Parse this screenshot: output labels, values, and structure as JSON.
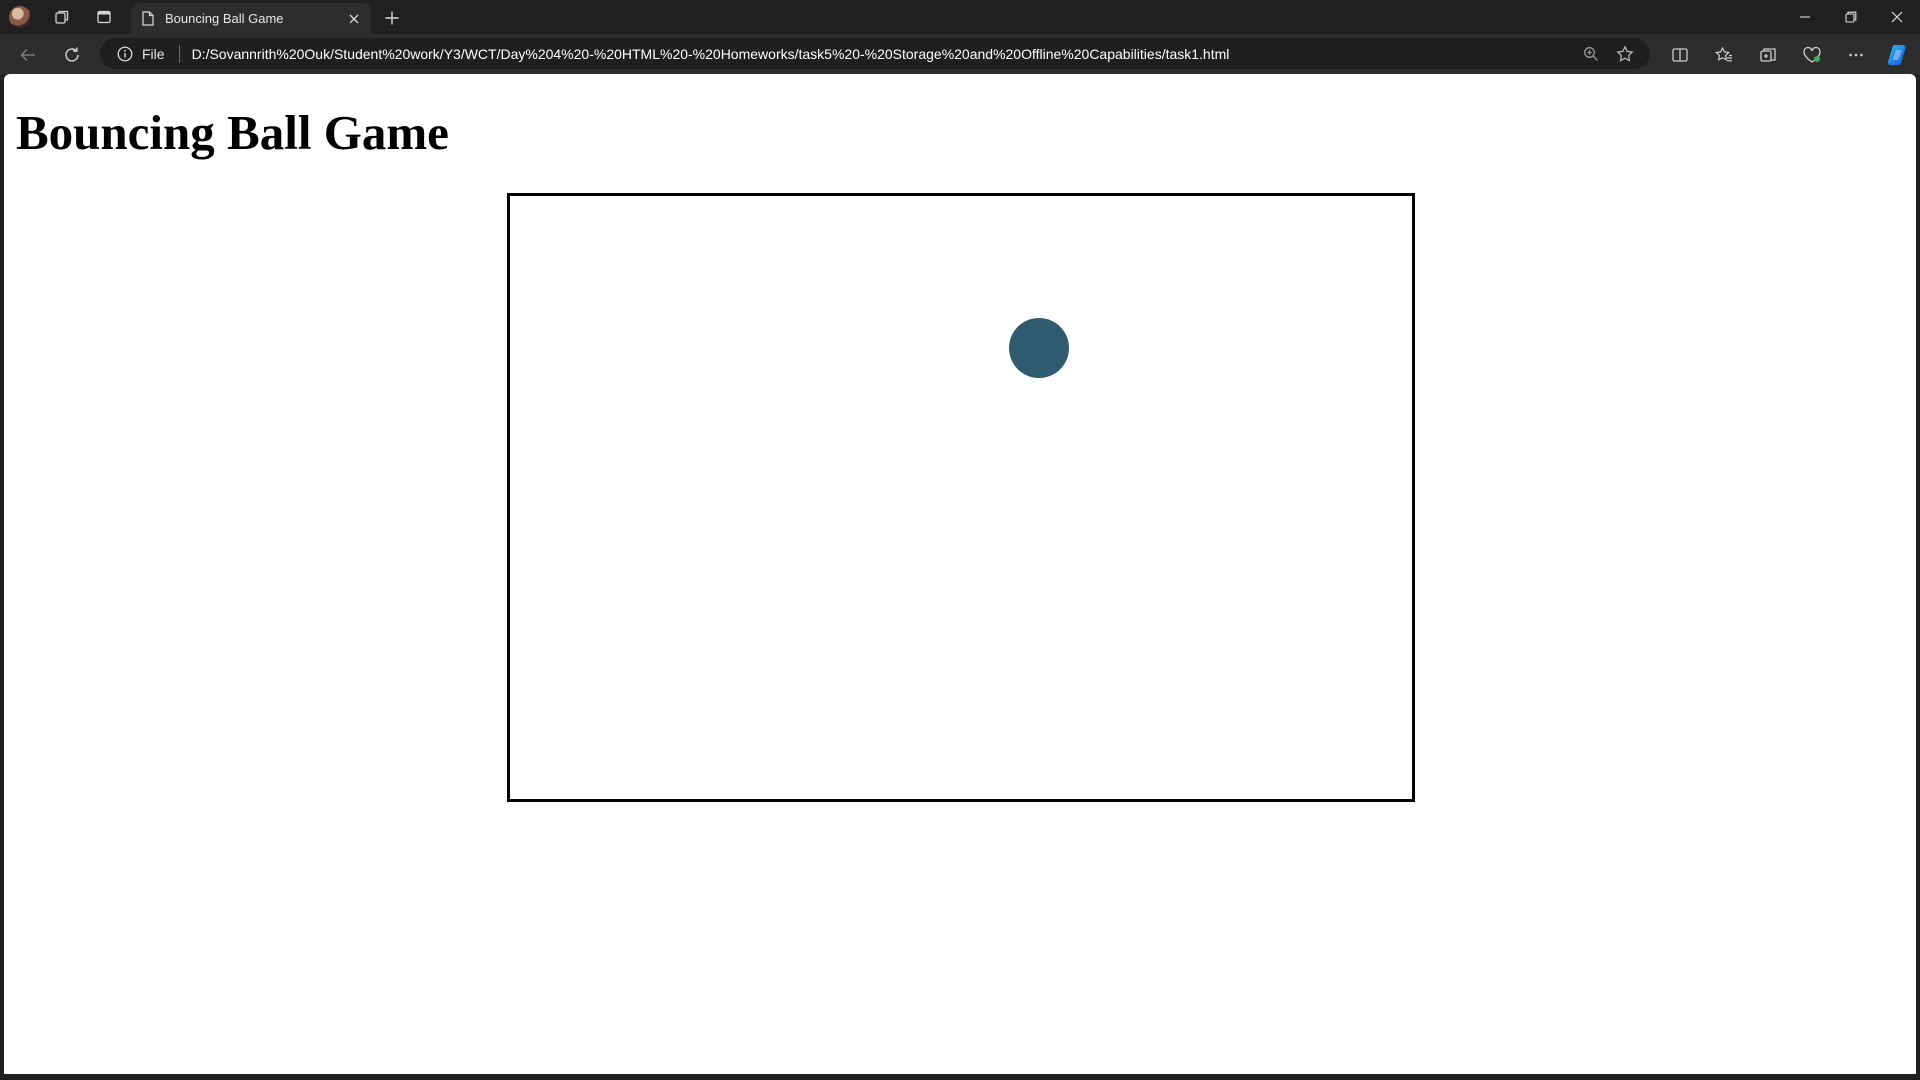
{
  "tab": {
    "title": "Bouncing Ball Game"
  },
  "address_bar": {
    "scheme_label": "File",
    "url": "D:/Sovannrith%20Ouk/Student%20work/Y3/WCT/Day%204%20-%20HTML%20-%20Homeworks/task5%20-%20Storage%20and%20Offline%20Capabilities/task1.html"
  },
  "page": {
    "heading": "Bouncing Ball Game"
  },
  "game": {
    "ball_color": "#2e5b6f",
    "border_color": "#000000",
    "background": "#ffffff"
  },
  "icons": [
    "profile-avatar-icon",
    "workspaces-icon",
    "tab-actions-icon",
    "page-icon",
    "close-icon",
    "plus-icon",
    "minimize-icon",
    "restore-icon",
    "close-window-icon",
    "back-icon",
    "refresh-icon",
    "info-icon",
    "zoom-icon",
    "favorite-star-icon",
    "split-screen-icon",
    "favorites-icon",
    "collections-icon",
    "browser-essentials-icon",
    "more-icon",
    "copilot-icon"
  ]
}
